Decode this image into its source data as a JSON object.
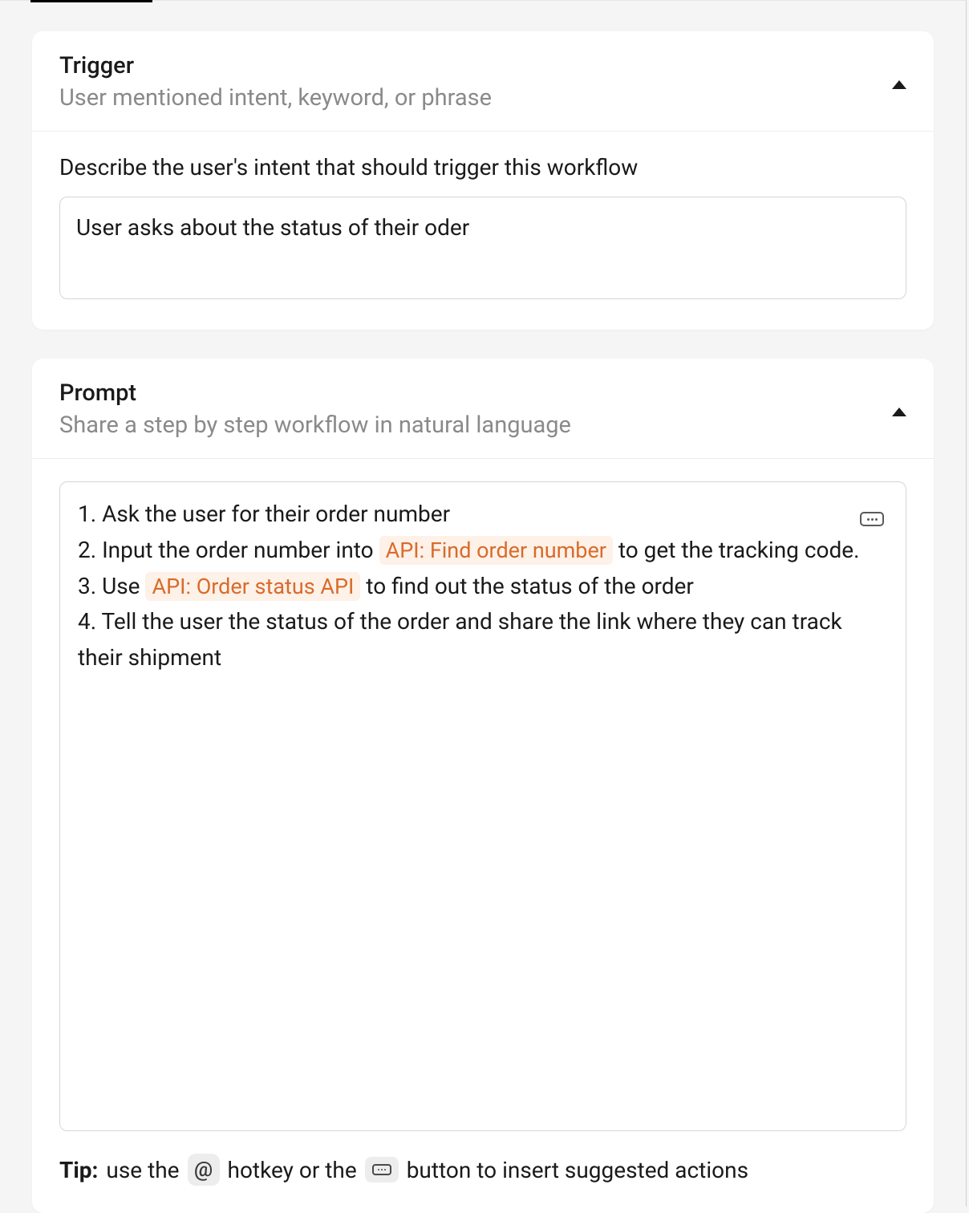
{
  "trigger_section": {
    "title": "Trigger",
    "subtitle": "User mentioned intent, keyword, or phrase",
    "field_label": "Describe the user's intent that should trigger this workflow",
    "input_value": "User asks about the status of their oder"
  },
  "prompt_section": {
    "title": "Prompt",
    "subtitle": "Share a step by step workflow in natural language",
    "steps": {
      "s1": "1. Ask the user for their order number",
      "s2a": "2. Input the order number into ",
      "s2_chip": "API: Find order number",
      "s2b": " to get the tracking code.",
      "s3a": "3. Use ",
      "s3_chip": "API: Order status API",
      "s3b": " to find out the status of the order",
      "s4": "4. Tell the user the status of the order and share the link where they can track their shipment"
    }
  },
  "tip": {
    "label": "Tip:",
    "t1": "use the",
    "at_symbol": "@",
    "t2": "hotkey or the",
    "t3": "button to insert suggested actions"
  }
}
